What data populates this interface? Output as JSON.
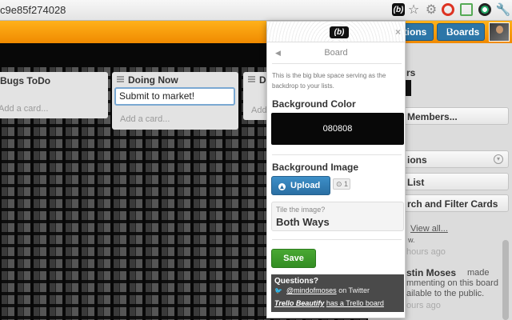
{
  "browser": {
    "url_fragment": "c9e85f274028",
    "ext_b_label": "(b)",
    "star_icon": "☆",
    "gear_icon": "⚙",
    "wrench_icon": "🔧"
  },
  "header": {
    "notifications_label": "ations",
    "boards_label": "Boards"
  },
  "lists": [
    {
      "title": "Bugs ToDo",
      "add_card": "Add a card..."
    },
    {
      "title": "Doing Now",
      "card_input": "Submit to market!",
      "add_card": "Add a card..."
    },
    {
      "title": "D",
      "add_card": "Add"
    }
  ],
  "sidebar": {
    "members_title": "rs",
    "add_members": "Members...",
    "options": "ions",
    "lists": "List",
    "search": "rch and Filter Cards",
    "view_all": "View all...",
    "activity1_w": "w.",
    "activity1_time": "hours ago",
    "activity2_name": "stin Moses",
    "activity2_made": "made",
    "activity2_line2": "mmenting on this board",
    "activity2_line3": "ailable to the public.",
    "activity2_time": "ours ago"
  },
  "popover": {
    "logo": "(b)",
    "close": "×",
    "back": "◀",
    "title": "Board",
    "desc": "This is the big blue space serving as the backdrop to your lists.",
    "bg_color_label": "Background Color",
    "bg_color_value": "080808",
    "bg_image_label": "Background Image",
    "upload_label": "Upload",
    "count": "1",
    "tile_label": "Tile the image?",
    "tile_value": "Both Ways",
    "save_label": "Save",
    "footer_q": "Questions?",
    "twitter_handle": "@mindofmoses",
    "twitter_suffix": "on Twitter",
    "trello_link": "Trello Beautify",
    "trello_suffix": "has a Trello board"
  },
  "colors": {
    "board_bg": "#080808",
    "header_orange": "#f08a00",
    "button_blue": "#2d76a8",
    "save_green": "#338d23"
  }
}
